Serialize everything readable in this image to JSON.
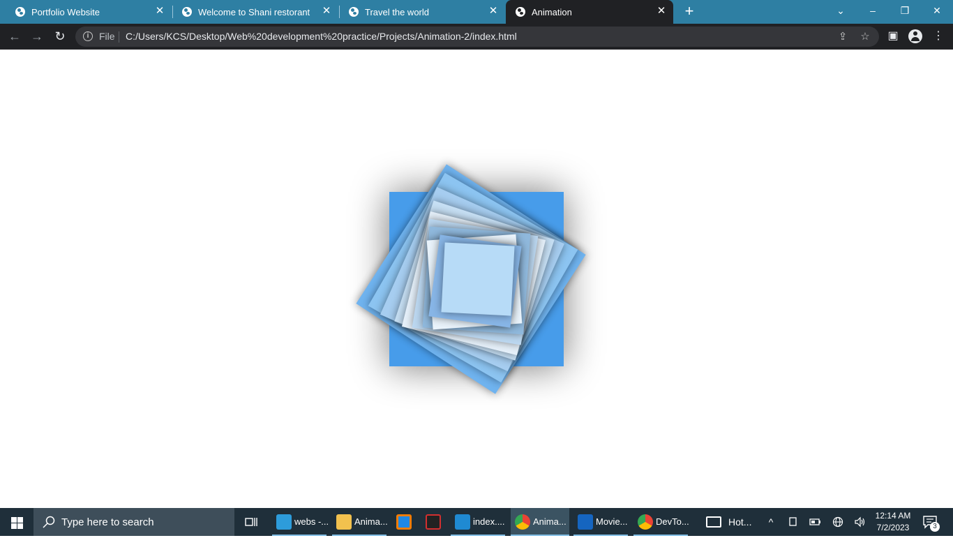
{
  "browser": {
    "tabs": [
      {
        "title": "Portfolio Website",
        "active": false
      },
      {
        "title": "Welcome to Shani restorant",
        "active": false
      },
      {
        "title": "Travel the world",
        "active": false
      },
      {
        "title": "Animation",
        "active": true
      }
    ],
    "new_tab_symbol": "+",
    "close_symbol": "✕",
    "window_controls": {
      "tab_search": "⌄",
      "minimize": "–",
      "restore": "❐",
      "close": "✕"
    },
    "toolbar": {
      "back_symbol": "←",
      "forward_symbol": "→",
      "reload_symbol": "↻",
      "file_chip": "File",
      "url": "C:/Users/KCS/Desktop/Web%20development%20practice/Projects/Animation-2/index.html",
      "share_symbol": "⇪",
      "bookmark_symbol": "☆",
      "sidepanel_symbol": "▣",
      "menu_symbol": "⋮"
    }
  },
  "animation": {
    "background_square_color": "#479cea",
    "square_colors": [
      "#6fb3ef",
      "#8cc4f1",
      "#a6cdf0",
      "#c6dff4",
      "#e5f0fa",
      "#bbd7f0",
      "#8fb8dc",
      "#e9f3fb",
      "#87b5e6",
      "#b7dbf7"
    ]
  },
  "taskbar": {
    "search_placeholder": "Type here to search",
    "items": [
      {
        "label": "webs -...",
        "icon": "cube-icon",
        "color": "#2d9cdb"
      },
      {
        "label": "Anima...",
        "icon": "folder-icon",
        "color": "#f2c14e"
      },
      {
        "label": "",
        "icon": "virtualbox-icon",
        "color": "#1e88e5"
      },
      {
        "label": "",
        "icon": "archive-icon",
        "color": "#d32f2f"
      },
      {
        "label": "index....",
        "icon": "vscode-icon",
        "color": "#1f8ad2"
      },
      {
        "label": "Anima...",
        "icon": "chrome-icon",
        "color": "#4caf50"
      },
      {
        "label": "Movie...",
        "icon": "movie-maker-icon",
        "color": "#1565c0"
      },
      {
        "label": "DevTo...",
        "icon": "chrome-icon",
        "color": "#4caf50"
      },
      {
        "label": "Hot...",
        "icon": "news-icon",
        "color": "#ffffff"
      }
    ],
    "tray": {
      "chevron": "^",
      "clock_time": "12:14 AM",
      "clock_date": "7/2/2023",
      "notification_count": "3"
    }
  }
}
